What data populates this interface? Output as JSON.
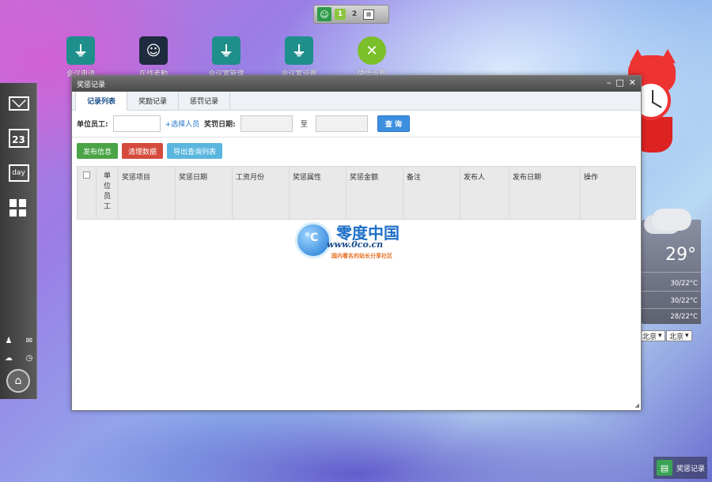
{
  "desktop": {
    "pager": {
      "pages": [
        "1",
        "2"
      ],
      "active_page": "1"
    },
    "icons": [
      {
        "label": "会议申请",
        "color": "#1f8f8c",
        "icon": "plug-icon"
      },
      {
        "label": "在线考勤",
        "color": "#1f2b3f",
        "icon": "person-icon"
      },
      {
        "label": "会议室管理",
        "color": "#1f8f8c",
        "icon": "plug-icon"
      },
      {
        "label": "会议室设置",
        "color": "#1f8f8c",
        "icon": "plug-icon"
      },
      {
        "label": "微信设置",
        "color": "#7bbf2a",
        "icon": "x-icon"
      }
    ],
    "dock": {
      "calendar_day": "23",
      "day_label": "day"
    },
    "weather": {
      "temperature": "29°",
      "forecast": [
        "30/22°C",
        "30/22°C",
        "28/22°C"
      ],
      "city_1": "北京",
      "city_2": "北京"
    },
    "taskbar": {
      "label": "奖惩记录"
    }
  },
  "window": {
    "title": "奖惩记录",
    "tabs": [
      {
        "label": "记录列表",
        "active": true
      },
      {
        "label": "奖励记录",
        "active": false
      },
      {
        "label": "惩罚记录",
        "active": false
      }
    ],
    "filter": {
      "employee_label": "单位员工:",
      "employee_value": "",
      "select_person_link": "+选择人员",
      "date_label": "奖罚日期:",
      "date_from": "",
      "to_label": "至",
      "date_to": "",
      "query_button": "查 询"
    },
    "actions": {
      "publish": "发布信息",
      "clear": "清理数据",
      "export": "导出查询列表"
    },
    "table": {
      "unit_employee_chars": [
        "单",
        "位",
        "员",
        "工"
      ],
      "columns": [
        "奖惩项目",
        "奖惩日期",
        "工资月份",
        "奖惩属性",
        "奖惩金额",
        "备注",
        "发布人",
        "发布日期",
        "操作"
      ],
      "rows": []
    },
    "watermark": {
      "logo_text": "°C",
      "brand": "零度中国",
      "url": "www.0co.cn",
      "slogan": "国内著名的站长分享社区"
    }
  }
}
